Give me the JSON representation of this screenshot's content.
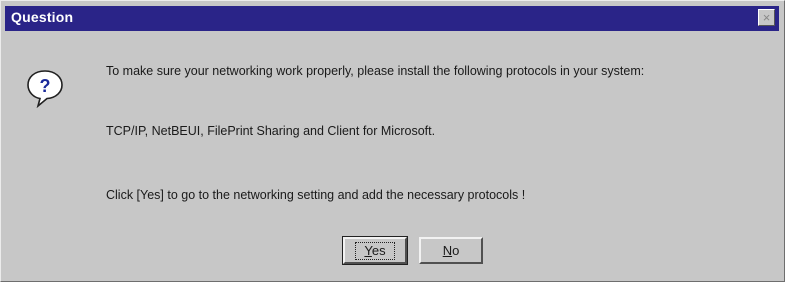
{
  "dialog": {
    "title": "Question",
    "close_glyph": "×",
    "icon": "question-icon",
    "message_line1": "To make sure your networking work properly, please install the following protocols in your system:",
    "message_line2": "TCP/IP, NetBEUI, FilePrint Sharing and Client for Microsoft.",
    "message_line3": "Click [Yes] to go to the networking setting and add the necessary protocols !",
    "buttons": {
      "yes": {
        "mnemonic": "Y",
        "rest": "es"
      },
      "no": {
        "mnemonic": "N",
        "rest": "o"
      }
    }
  },
  "colors": {
    "titlebar": "#2a2488",
    "face": "#c7c7c7",
    "icon_bubble": "#ffffff",
    "icon_glyph": "#1a2a9a"
  }
}
